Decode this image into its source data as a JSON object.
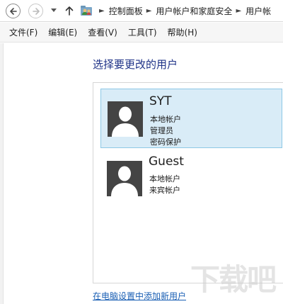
{
  "address_bar": {
    "crumbs": [
      "控制面板",
      "用户帐户和家庭安全",
      "用户帐"
    ]
  },
  "menu": {
    "items": [
      "文件(F)",
      "编辑(E)",
      "查看(V)",
      "工具(T)",
      "帮助(H)"
    ]
  },
  "content": {
    "heading": "选择要更改的用户",
    "users": [
      {
        "name": "SYT",
        "details": [
          "本地帐户",
          "管理员",
          "密码保护"
        ],
        "selected": true
      },
      {
        "name": "Guest",
        "details": [
          "本地帐户",
          "来宾帐户"
        ],
        "selected": false
      }
    ],
    "add_user_link": "在电脑设置中添加新用户"
  },
  "watermark": "下载吧",
  "colors": {
    "heading": "#1e3287",
    "selected_bg": "#d9ecf7",
    "selected_border": "#8ec8e6",
    "link": "#1a5fb4",
    "avatar": "#444444"
  }
}
